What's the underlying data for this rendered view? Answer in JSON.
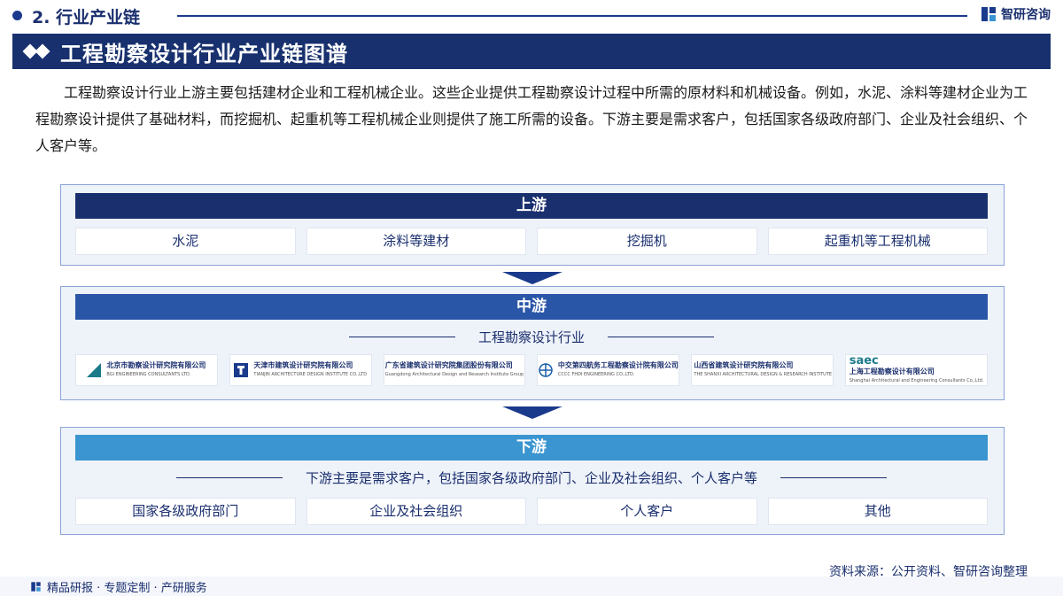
{
  "header": {
    "section": "2. 行业产业链",
    "brand": "智研咨询"
  },
  "banner": {
    "title": "工程勘察设计行业产业链图谱"
  },
  "intro": "工程勘察设计行业上游主要包括建材企业和工程机械企业。这些企业提供工程勘察设计过程中所需的原材料和机械设备。例如，水泥、涂料等建材企业为工程勘察设计提供了基础材料，而挖掘机、起重机等工程机械企业则提供了施工所需的设备。下游主要是需求客户，包括国家各级政府部门、企业及社会组织、个人客户等。",
  "upstream": {
    "label": "上游",
    "items": [
      "水泥",
      "涂料等建材",
      "挖掘机",
      "起重机等工程机械"
    ]
  },
  "midstream": {
    "label": "中游",
    "subtitle": "工程勘察设计行业",
    "companies": [
      {
        "cn": "北京市勘察设计研究院有限公司",
        "en": "BGI ENGINEERING CONSULTANTS LTD.",
        "color": "#1b7a8a"
      },
      {
        "cn": "天津市建筑设计研究院有限公司",
        "en": "TIANJIN ARCHITECTURE DESIGN INSTITUTE CO.,LTD",
        "color": "#1a3a8c"
      },
      {
        "cn": "广东省建筑设计研究院集团股份有限公司",
        "en": "Guangdong Architectural Design and Research Institute Group Co., Ltd.",
        "color": "#c0392b"
      },
      {
        "cn": "中交第四航务工程勘察设计院有限公司",
        "en": "CCCC FHDI ENGINEERING CO.,LTD.",
        "color": "#1a5fa8"
      },
      {
        "cn": "山西省建筑设计研究院有限公司",
        "en": "THE SHANXI ARCHITECTURAL DESIGN & RESEARCH INSTITUTE CO.,LTD",
        "color": "#c0392b"
      },
      {
        "cn": "上海工程勘察设计有限公司",
        "en": "Shanghai Architectural and Engineering Consultants Co.,Ltd.",
        "color": "#1b7a8a",
        "logo_text": "saec"
      }
    ]
  },
  "downstream": {
    "label": "下游",
    "subtitle": "下游主要是需求客户，包括国家各级政府部门、企业及社会组织、个人客户等",
    "items": [
      "国家各级政府部门",
      "企业及社会组织",
      "个人客户",
      "其他"
    ]
  },
  "source": "资料来源：公开资料、智研咨询整理",
  "footer": {
    "text": "精品研报 · 专题定制 · 产研服务"
  },
  "colors": {
    "navy": "#18316e",
    "upstream_head": "#1a2f6e",
    "midstream_head": "#2a56a8",
    "downstream_head": "#3a95d0"
  }
}
